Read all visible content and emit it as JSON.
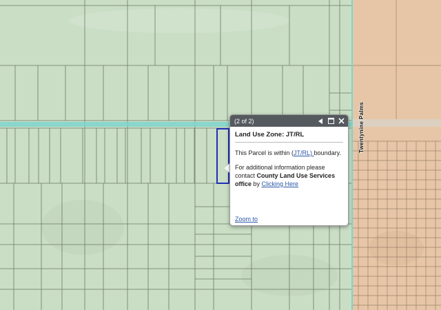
{
  "map": {
    "road_name": "Twentynine Palms",
    "colors": {
      "zone_green": "#c9dec5",
      "zone_tan": "#e6c6a6",
      "parcel_line": "#6b7a66",
      "road_highlight": "#7fd3cd",
      "selected_parcel": "#1e2fb8"
    }
  },
  "popup": {
    "count": "(2 of 2)",
    "prev_icon": "triangle-left-icon",
    "maximize_icon": "maximize-icon",
    "close_icon": "close-icon",
    "title": "Land Use Zone: JT/RL",
    "line1_prefix": "This Parcel is within (",
    "line1_link": "JT/RL) ",
    "line1_suffix": "boundary.",
    "line2_prefix": "For additional information please contact ",
    "line2_bold": "County Land Use Services office",
    "line2_middle": " by ",
    "line2_link": "Clicking Here",
    "zoom_link": "Zoom to"
  }
}
